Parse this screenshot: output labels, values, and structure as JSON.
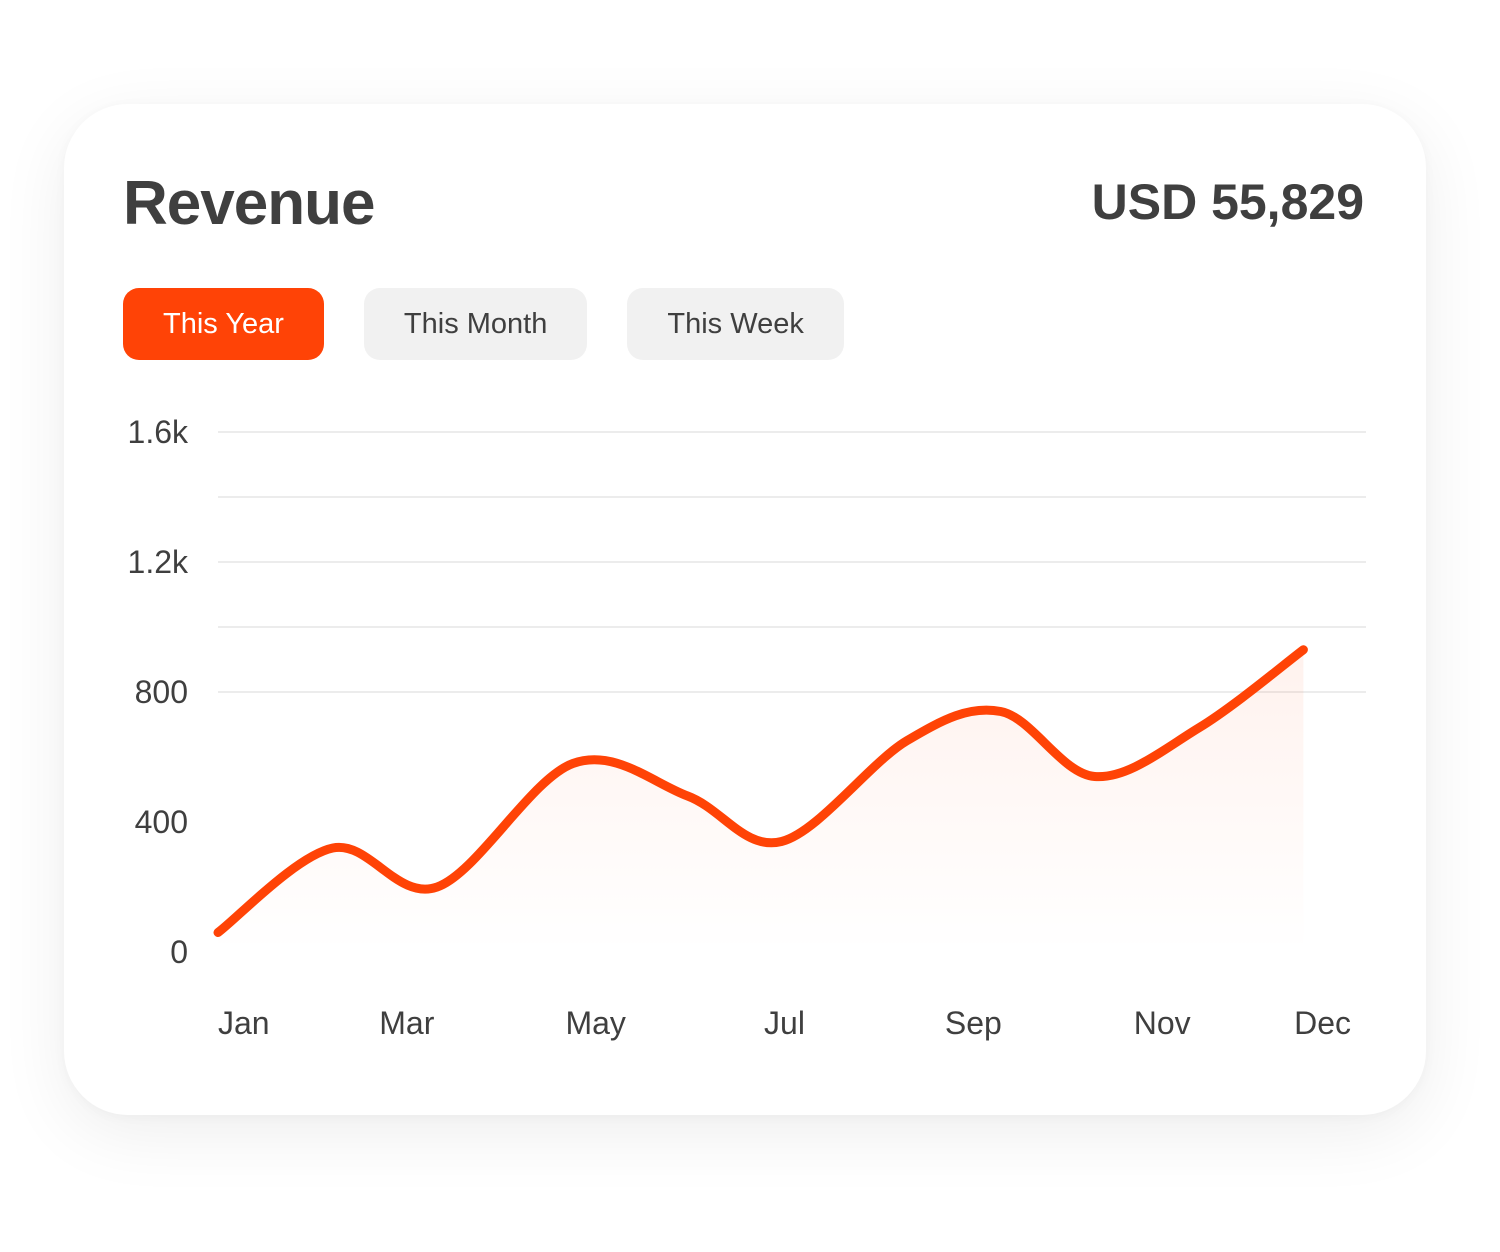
{
  "header": {
    "title": "Revenue",
    "total": "USD 55,829"
  },
  "tabs": [
    {
      "label": "This Year",
      "active": true
    },
    {
      "label": "This Month",
      "active": false
    },
    {
      "label": "This Week",
      "active": false
    }
  ],
  "colors": {
    "accent": "#ff4306",
    "text": "#3f3f3f",
    "grid": "#ececec",
    "tab_bg": "#f1f1f1"
  },
  "chart_data": {
    "type": "area",
    "title": "Revenue",
    "xlabel": "",
    "ylabel": "",
    "ylim": [
      0,
      1600
    ],
    "yticks": [
      {
        "value": 0,
        "label": "0"
      },
      {
        "value": 400,
        "label": "400"
      },
      {
        "value": 800,
        "label": "800"
      },
      {
        "value": 1200,
        "label": "1.2k"
      },
      {
        "value": 1600,
        "label": "1.6k"
      }
    ],
    "xticks": [
      "Jan",
      "Mar",
      "May",
      "Jul",
      "Sep",
      "Nov",
      "Dec"
    ],
    "grid": true,
    "series": [
      {
        "color": "#ff4306",
        "points": [
          {
            "x": 1.0,
            "y": 60
          },
          {
            "x": 2.1,
            "y": 320
          },
          {
            "x": 3.1,
            "y": 200
          },
          {
            "x": 4.4,
            "y": 580
          },
          {
            "x": 5.5,
            "y": 480
          },
          {
            "x": 6.4,
            "y": 340
          },
          {
            "x": 7.6,
            "y": 650
          },
          {
            "x": 8.5,
            "y": 740
          },
          {
            "x": 9.4,
            "y": 540
          },
          {
            "x": 10.4,
            "y": 690
          },
          {
            "x": 11.4,
            "y": 930
          }
        ]
      }
    ]
  }
}
